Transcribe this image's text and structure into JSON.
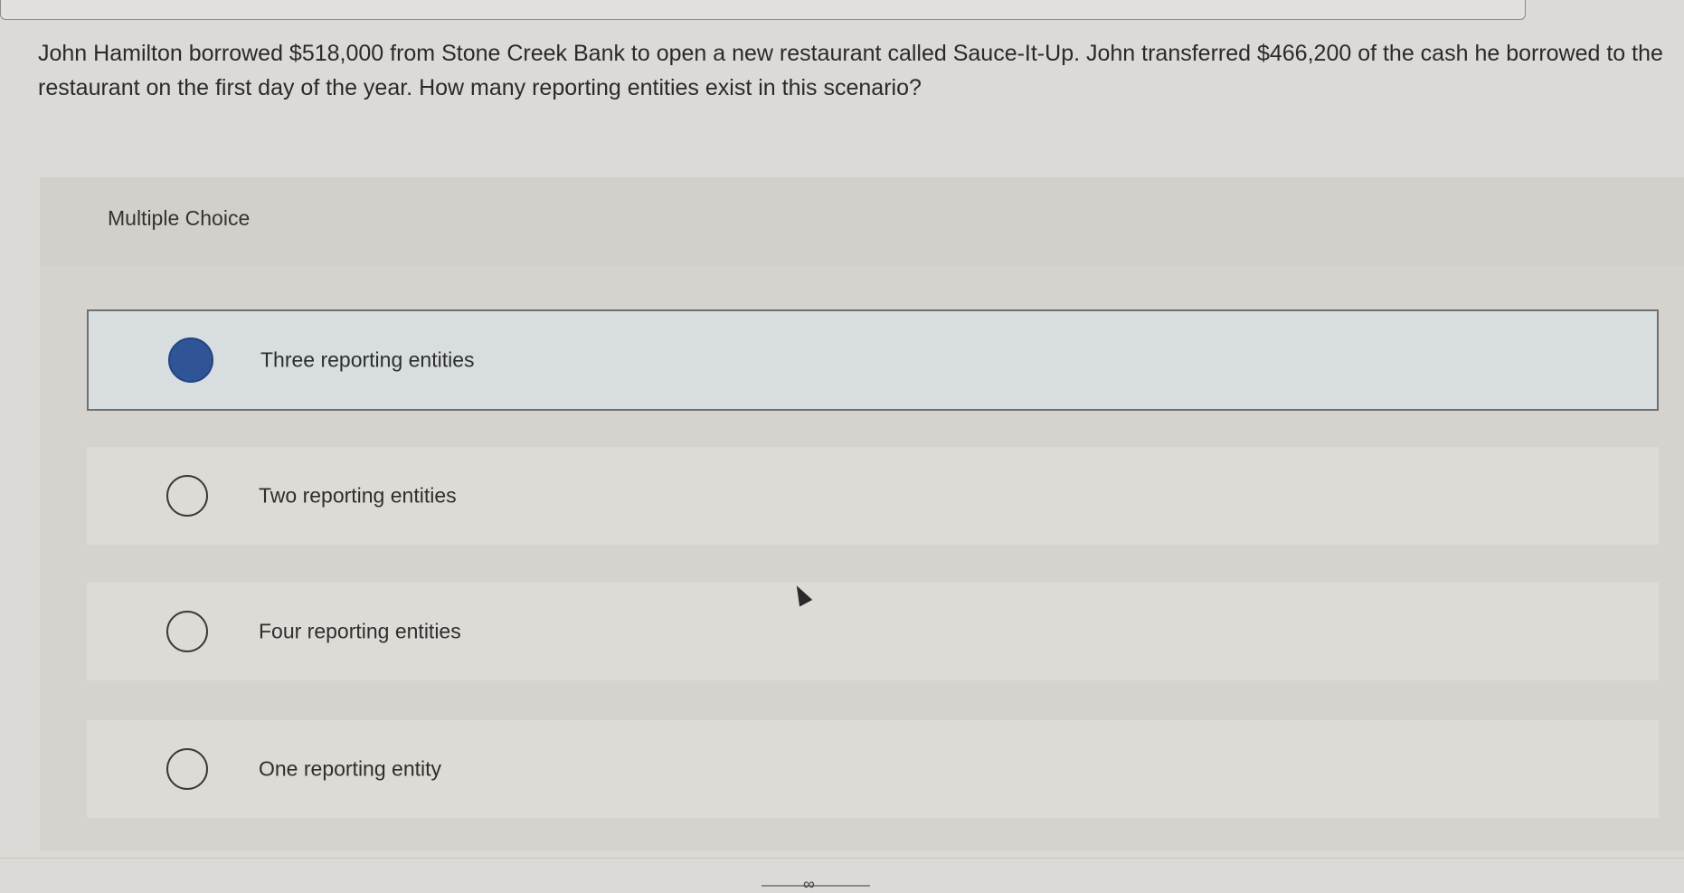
{
  "question": {
    "text": "John Hamilton borrowed $518,000 from Stone Creek Bank to open a new restaurant called Sauce-It-Up. John transferred $466,200 of the cash he borrowed to the restaurant on the first day of the year. How many reporting entities exist in this scenario?"
  },
  "multiple_choice": {
    "title": "Multiple Choice",
    "options": [
      {
        "label": "Three reporting entities",
        "selected": true
      },
      {
        "label": "Two reporting entities",
        "selected": false
      },
      {
        "label": "Four reporting entities",
        "selected": false
      },
      {
        "label": "One reporting entity",
        "selected": false
      }
    ]
  },
  "colors": {
    "selected_radio": "#2f5597",
    "background": "#dcdad6"
  },
  "icons": {
    "cursor": "mouse-pointer-icon",
    "bottom": "link-icon"
  }
}
